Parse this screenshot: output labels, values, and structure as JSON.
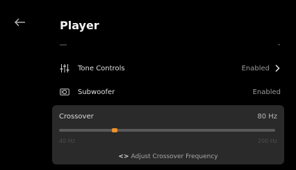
{
  "header": {
    "title": "Player",
    "back_icon": "back-arrow-icon"
  },
  "settings": {
    "tone_controls": {
      "icon": "equalizer-sliders-icon",
      "label": "Tone Controls",
      "value": "Enabled",
      "chevron_icon": "chevron-right-icon"
    },
    "subwoofer": {
      "icon": "subwoofer-icon",
      "label": "Subwoofer",
      "value": "Enabled"
    }
  },
  "crossover": {
    "label": "Crossover",
    "value": "80 Hz",
    "slider": {
      "min_label": "40 Hz",
      "max_label": "200 Hz",
      "fraction": 0.25
    },
    "hint_icon": "left-right-arrows-icon",
    "hint": "Adjust Crossover Frequency"
  },
  "colors": {
    "background": "#000000",
    "panel": "#2a2a2a",
    "accent": "#f0922b"
  }
}
